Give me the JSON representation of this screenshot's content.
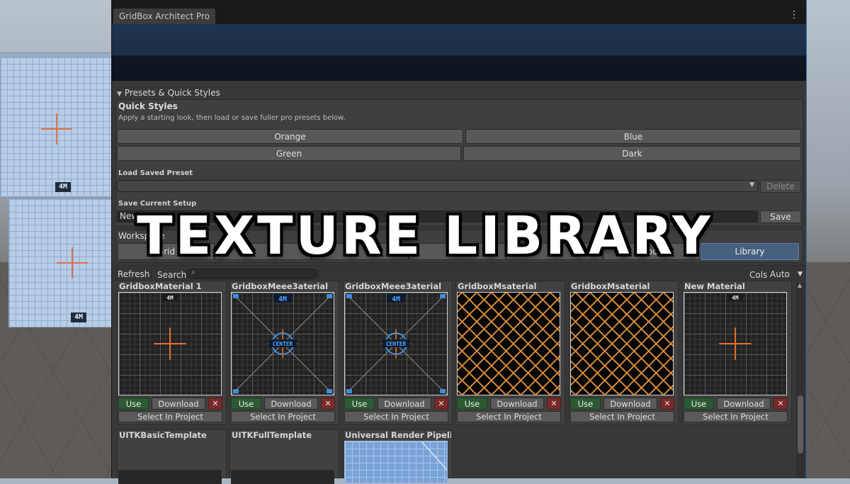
{
  "window": {
    "tab_title": "GridBox Architect Pro"
  },
  "presets": {
    "section_title": "Presets & Quick Styles",
    "quick_styles": {
      "title": "Quick Styles",
      "hint": "Apply a starting look, then load or save fuller pro presets below.",
      "buttons": [
        "Orange",
        "Blue",
        "Green",
        "Dark"
      ]
    },
    "load": {
      "label": "Load Saved Preset",
      "value": "",
      "delete_label": "Delete"
    },
    "save": {
      "label": "Save Current Setup",
      "value": "New Preset",
      "save_label": "Save"
    }
  },
  "workspace": {
    "title": "Workspace",
    "tabs": [
      {
        "label": "Grid"
      },
      {
        "label": ""
      },
      {
        "label": ""
      },
      {
        "label": "E"
      },
      {
        "label": ""
      },
      {
        "label": "xport"
      },
      {
        "label": "Library",
        "active": true
      }
    ]
  },
  "library": {
    "refresh_label": "Refresh",
    "search_label": "Search",
    "search_value": "",
    "cols_label": "Cols",
    "cols_value": "Auto",
    "use_label": "Use",
    "download_label": "Download",
    "delete_symbol": "✕",
    "select_label": "Select In Project",
    "materials": [
      {
        "name": "GridboxMaterial 1",
        "style": "grid-cross"
      },
      {
        "name": "GridboxMeee3aterial",
        "style": "grid-center"
      },
      {
        "name": "GridboxMeee3aterial",
        "style": "grid-center"
      },
      {
        "name": "GridboxMsaterial",
        "style": "orange-mesh"
      },
      {
        "name": "GridboxMsaterial",
        "style": "orange-mesh"
      },
      {
        "name": "New Material",
        "style": "grid-cross"
      }
    ],
    "templates": [
      {
        "name": "UITKBasicTemplate",
        "style": "dark"
      },
      {
        "name": "UITKFullTemplate",
        "style": "dark"
      },
      {
        "name": "Universal Render Pipeline/L",
        "style": "blue"
      }
    ],
    "thumb_tag_small": "4M",
    "thumb_tag_large": "4M",
    "thumb_center_text": "CENTER"
  },
  "overlay": {
    "title": "TEXTURE LIBRARY"
  },
  "colors": {
    "accent_orange": "#d9822b",
    "active_tab": "#46607e",
    "use_green": "#2d5a33",
    "delete_red": "#7a2a2a"
  }
}
